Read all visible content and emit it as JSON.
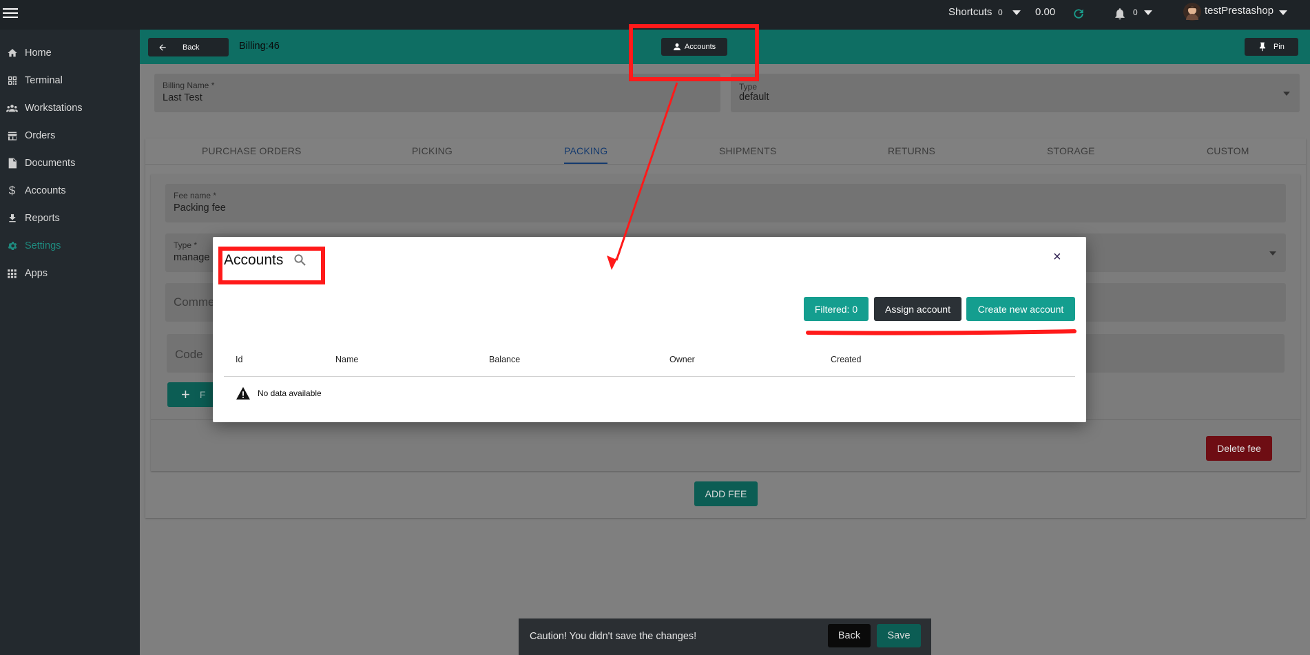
{
  "topbar": {
    "shortcuts_label": "Shortcuts",
    "shortcuts_count": "0",
    "balance": "0.00",
    "notifications_count": "0",
    "username": "testPrestashop"
  },
  "sidebar": {
    "items": [
      {
        "label": "Home",
        "icon": "home-icon"
      },
      {
        "label": "Terminal",
        "icon": "qr-code-icon"
      },
      {
        "label": "Workstations",
        "icon": "group-icon"
      },
      {
        "label": "Orders",
        "icon": "store-icon"
      },
      {
        "label": "Documents",
        "icon": "document-icon"
      },
      {
        "label": "Accounts",
        "icon": "dollar-icon"
      },
      {
        "label": "Reports",
        "icon": "download-icon"
      },
      {
        "label": "Settings",
        "icon": "gear-icon"
      },
      {
        "label": "Apps",
        "icon": "apps-grid-icon"
      }
    ],
    "active": "Settings"
  },
  "header": {
    "back_label": "Back",
    "title": "Billing:46",
    "accounts_label": "Accounts",
    "pin_label": "Pin"
  },
  "billing": {
    "name_label": "Billing Name *",
    "name_value": "Last Test",
    "type_label": "Type",
    "type_value": "default"
  },
  "tabs": [
    "PURCHASE ORDERS",
    "PICKING",
    "PACKING",
    "SHIPMENTS",
    "RETURNS",
    "STORAGE",
    "CUSTOM"
  ],
  "active_tab": "PACKING",
  "fee": {
    "fee_name_label": "Fee name *",
    "fee_name_value": "Packing fee",
    "type_label": "Type *",
    "type_value_partial": "manage",
    "comment_partial": "Comme",
    "code_label": "Code",
    "add_button_partial": "F",
    "delete_label": "Delete fee",
    "add_fee_label": "ADD FEE"
  },
  "modal": {
    "title": "Accounts",
    "close_label": "×",
    "filtered_label": "Filtered: 0",
    "assign_label": "Assign account",
    "create_label": "Create new account",
    "columns": [
      "Id",
      "Name",
      "Balance",
      "Owner",
      "Created"
    ],
    "empty_text": "No data available"
  },
  "caution": {
    "message": "Caution! You didn't save the changes!",
    "back_label": "Back",
    "save_label": "Save"
  },
  "colors": {
    "teal": "#149e8f",
    "dark": "#2b3136",
    "annotation_red": "#ff1a1a"
  }
}
